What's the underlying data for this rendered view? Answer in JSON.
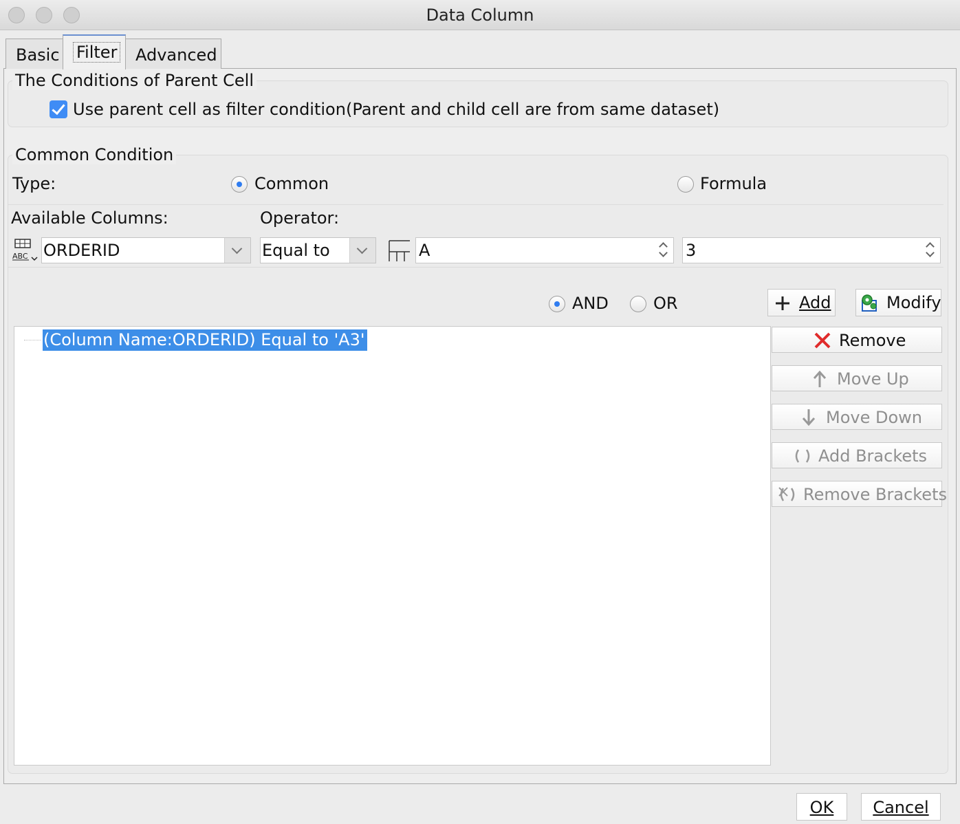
{
  "window": {
    "title": "Data Column"
  },
  "tabs": [
    {
      "label": "Basic"
    },
    {
      "label": "Filter"
    },
    {
      "label": "Advanced"
    }
  ],
  "parent_cell": {
    "group_title": "The Conditions of Parent Cell",
    "checkbox_label": "Use parent cell as filter condition(Parent and child cell are from same dataset)",
    "checked": true
  },
  "common_condition": {
    "group_title": "Common Condition",
    "type_label": "Type:",
    "type_options": [
      "Common",
      "Formula"
    ],
    "type_selected": "Common",
    "available_columns_label": "Available Columns:",
    "operator_label": "Operator:",
    "column_value": "ORDERID",
    "operator_value": "Equal to",
    "value_field_1": "A",
    "value_field_2": "3"
  },
  "logic": {
    "options": [
      "AND",
      "OR"
    ],
    "selected": "AND"
  },
  "buttons": {
    "add": "Add",
    "modify": "Modify",
    "remove": "Remove",
    "move_up": "Move Up",
    "move_down": "Move Down",
    "add_brackets": "Add Brackets",
    "remove_brackets": "Remove Brackets"
  },
  "conditions": [
    {
      "text": "(Column Name:ORDERID) Equal to 'A3'",
      "selected": true
    }
  ],
  "footer": {
    "ok": "OK",
    "cancel": "Cancel"
  },
  "colors": {
    "accent": "#3d8ee8",
    "remove_red": "#e02b2b",
    "modify_green": "#3aa84a"
  }
}
